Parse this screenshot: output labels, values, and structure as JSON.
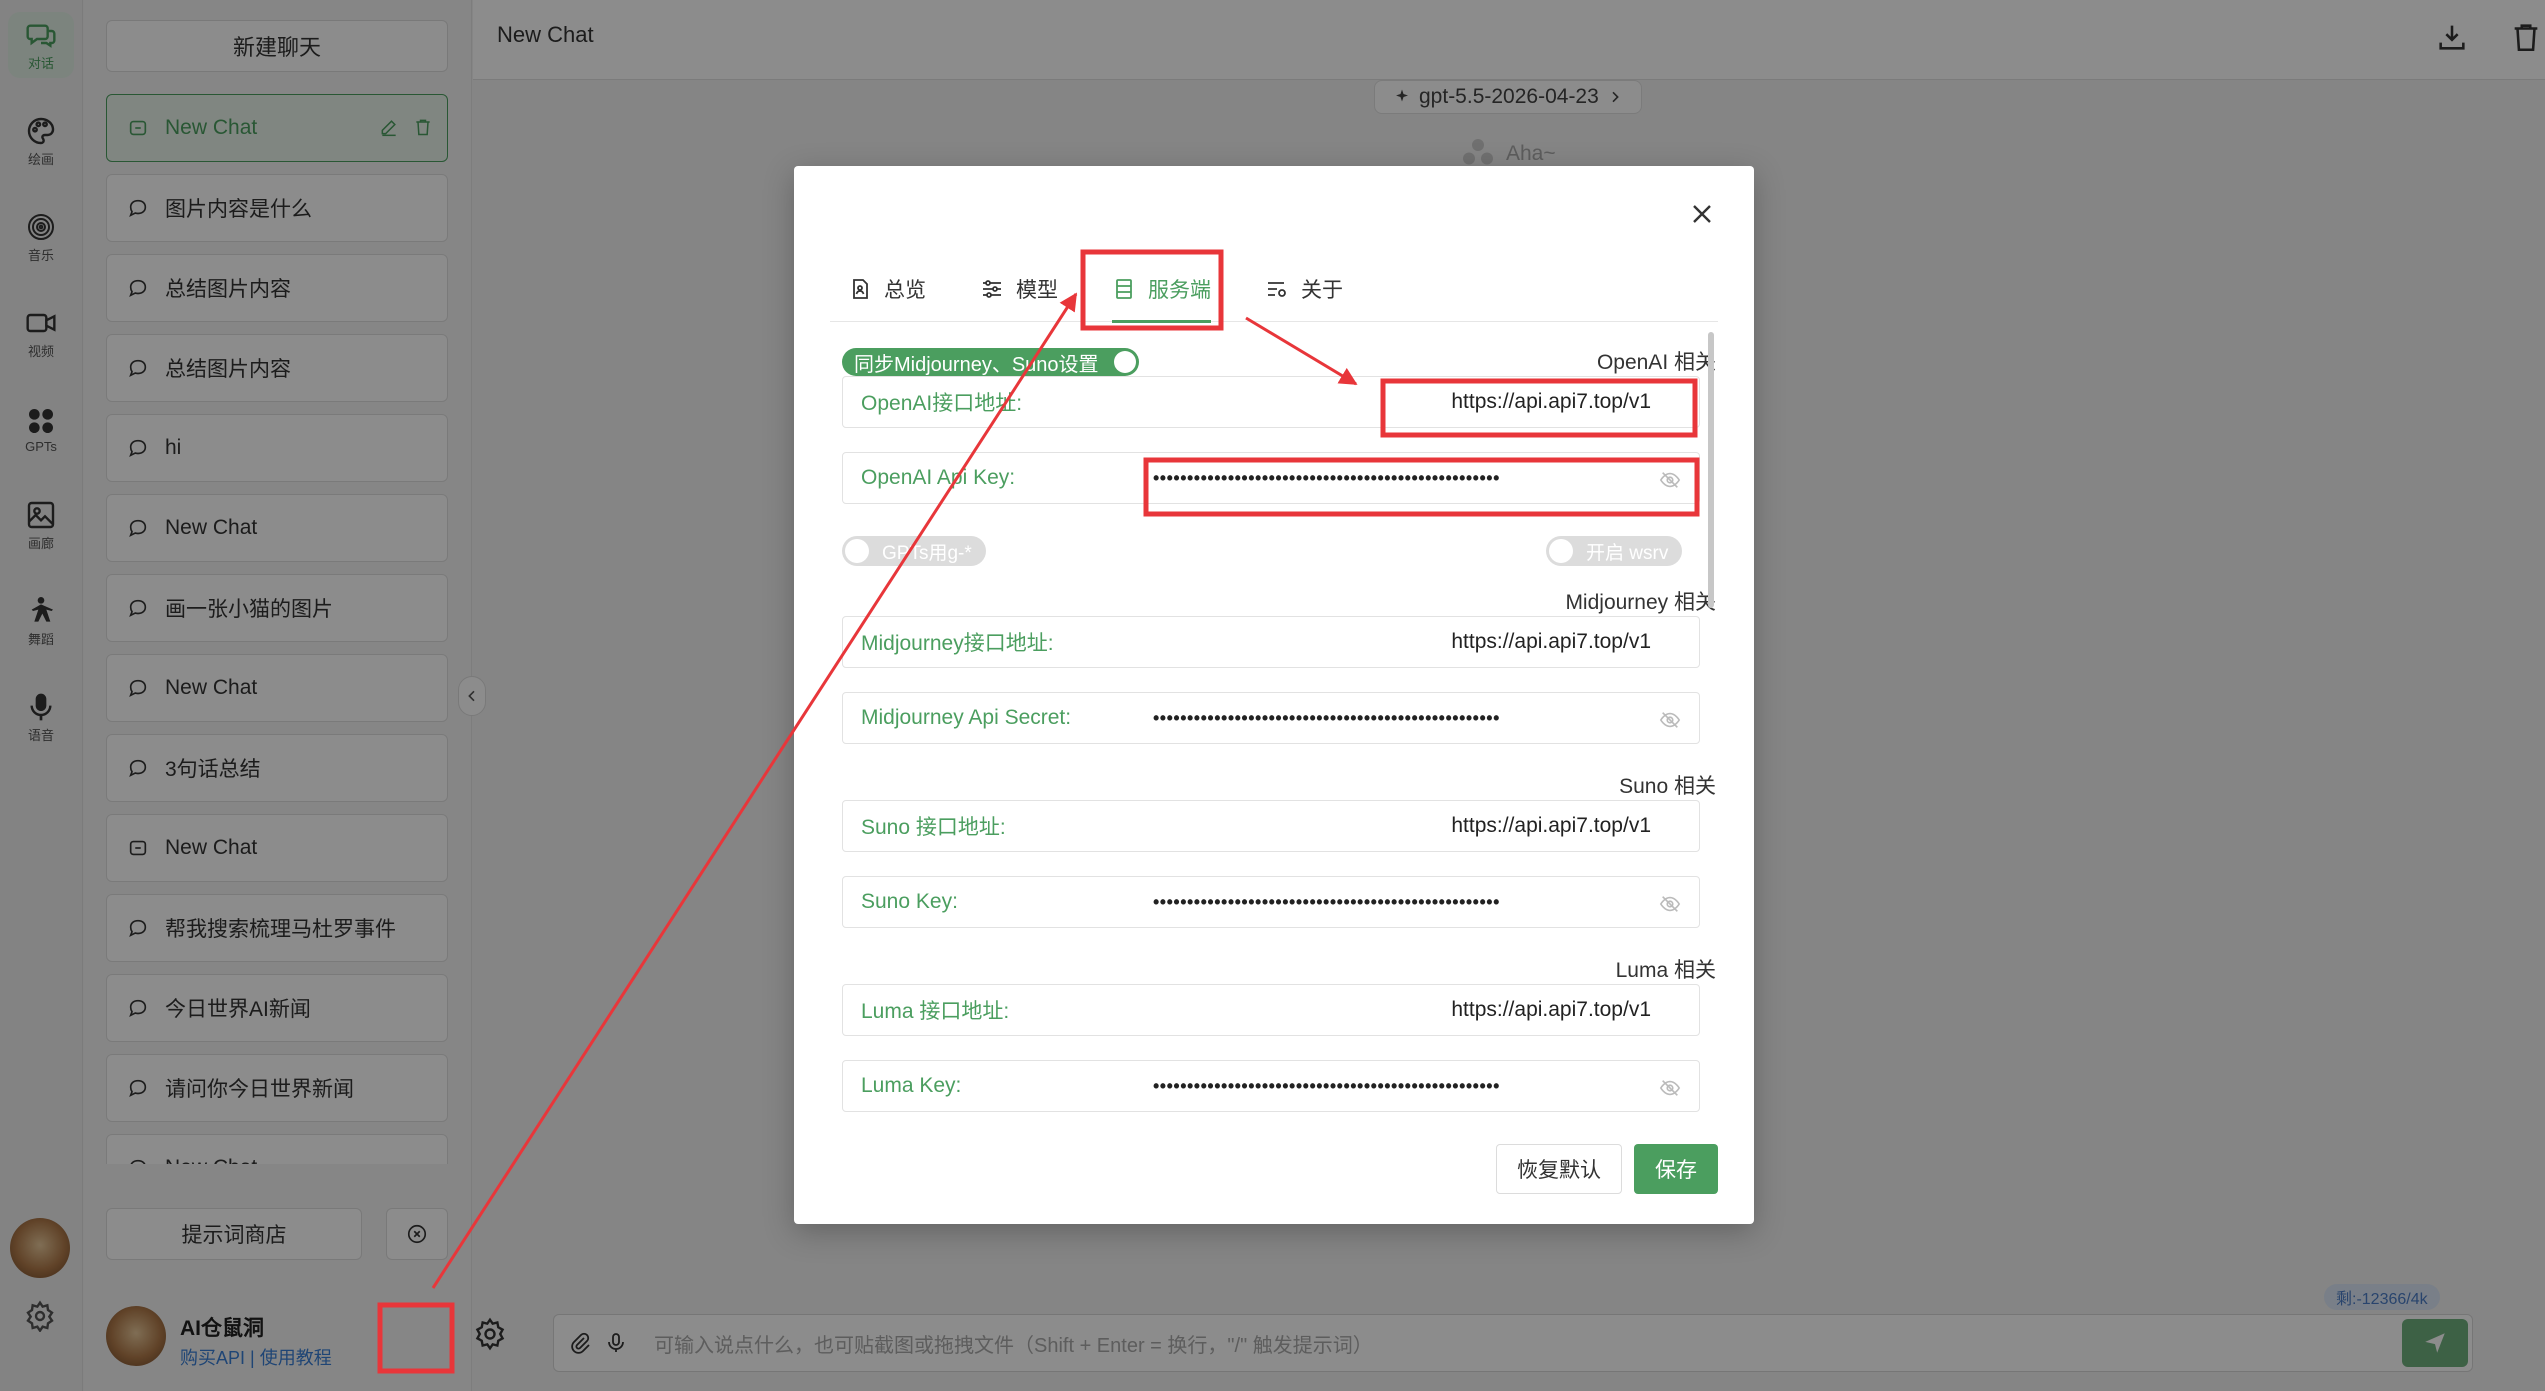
{
  "rail": {
    "items": [
      {
        "label": "对话",
        "icon": "chat-icon"
      },
      {
        "label": "绘画",
        "icon": "palette-icon"
      },
      {
        "label": "音乐",
        "icon": "music-icon"
      },
      {
        "label": "视频",
        "icon": "video-icon"
      },
      {
        "label": "GPTs",
        "icon": "apps-icon"
      },
      {
        "label": "画廊",
        "icon": "gallery-icon"
      },
      {
        "label": "舞蹈",
        "icon": "dance-icon"
      },
      {
        "label": "语音",
        "icon": "microphone-icon"
      }
    ]
  },
  "sidebar": {
    "new_chat": "新建聊天",
    "chats": [
      "New Chat",
      "图片内容是什么",
      "总结图片内容",
      "总结图片内容",
      "hi",
      "New Chat",
      "画一张小猫的图片",
      "New Chat",
      "3句话总结",
      "New Chat",
      "帮我搜索梳理马杜罗事件",
      "今日世界AI新闻",
      "请问你今日世界新闻",
      "New Chat"
    ],
    "prompt_store": "提示词商店",
    "user_name": "AI仓鼠洞",
    "buy_api": "购买API",
    "separator": "|",
    "tutorial": "使用教程"
  },
  "main": {
    "title": "New Chat",
    "model": "gpt-5.5-2026-04-23",
    "assistant_name": "Aha~",
    "input_placeholder": "可输入说点什么，也可贴截图或拖拽文件（Shift + Enter = 换行，\"/\" 触发提示词）",
    "token_badge": "剩:-12366/4k"
  },
  "modal": {
    "tabs": [
      "总览",
      "模型",
      "服务端",
      "关于"
    ],
    "active_tab": "服务端",
    "sync_label": "同步Midjourney、Suno设置",
    "sections": {
      "openai": "OpenAI 相关",
      "midjourney": "Midjourney 相关",
      "suno": "Suno 相关",
      "luma": "Luma 相关"
    },
    "fields": {
      "openai_url": {
        "label": "OpenAI接口地址:",
        "value": "https://api.api7.top/v1"
      },
      "openai_key": {
        "label": "OpenAI Api Key:",
        "value": "•••••••••••••••••••••••••••••••••••••••••••••••••••"
      },
      "mj_url": {
        "label": "Midjourney接口地址:",
        "value": "https://api.api7.top/v1"
      },
      "mj_key": {
        "label": "Midjourney Api Secret:",
        "value": "•••••••••••••••••••••••••••••••••••••••••••••••••••"
      },
      "suno_url": {
        "label": "Suno 接口地址:",
        "value": "https://api.api7.top/v1"
      },
      "suno_key": {
        "label": "Suno Key:",
        "value": "•••••••••••••••••••••••••••••••••••••••••••••••••••"
      },
      "luma_url": {
        "label": "Luma 接口地址:",
        "value": "https://api.api7.top/v1"
      },
      "luma_key": {
        "label": "Luma Key:",
        "value": "•••••••••••••••••••••••••••••••••••••••••••••••••••"
      }
    },
    "toggle_gpts": "GPTs用g-*",
    "toggle_wsrv": "开启 wsrv",
    "restore": "恢复默认",
    "save": "保存"
  },
  "colors": {
    "accent": "#4b9e5f",
    "annotation": "#e8363a"
  }
}
